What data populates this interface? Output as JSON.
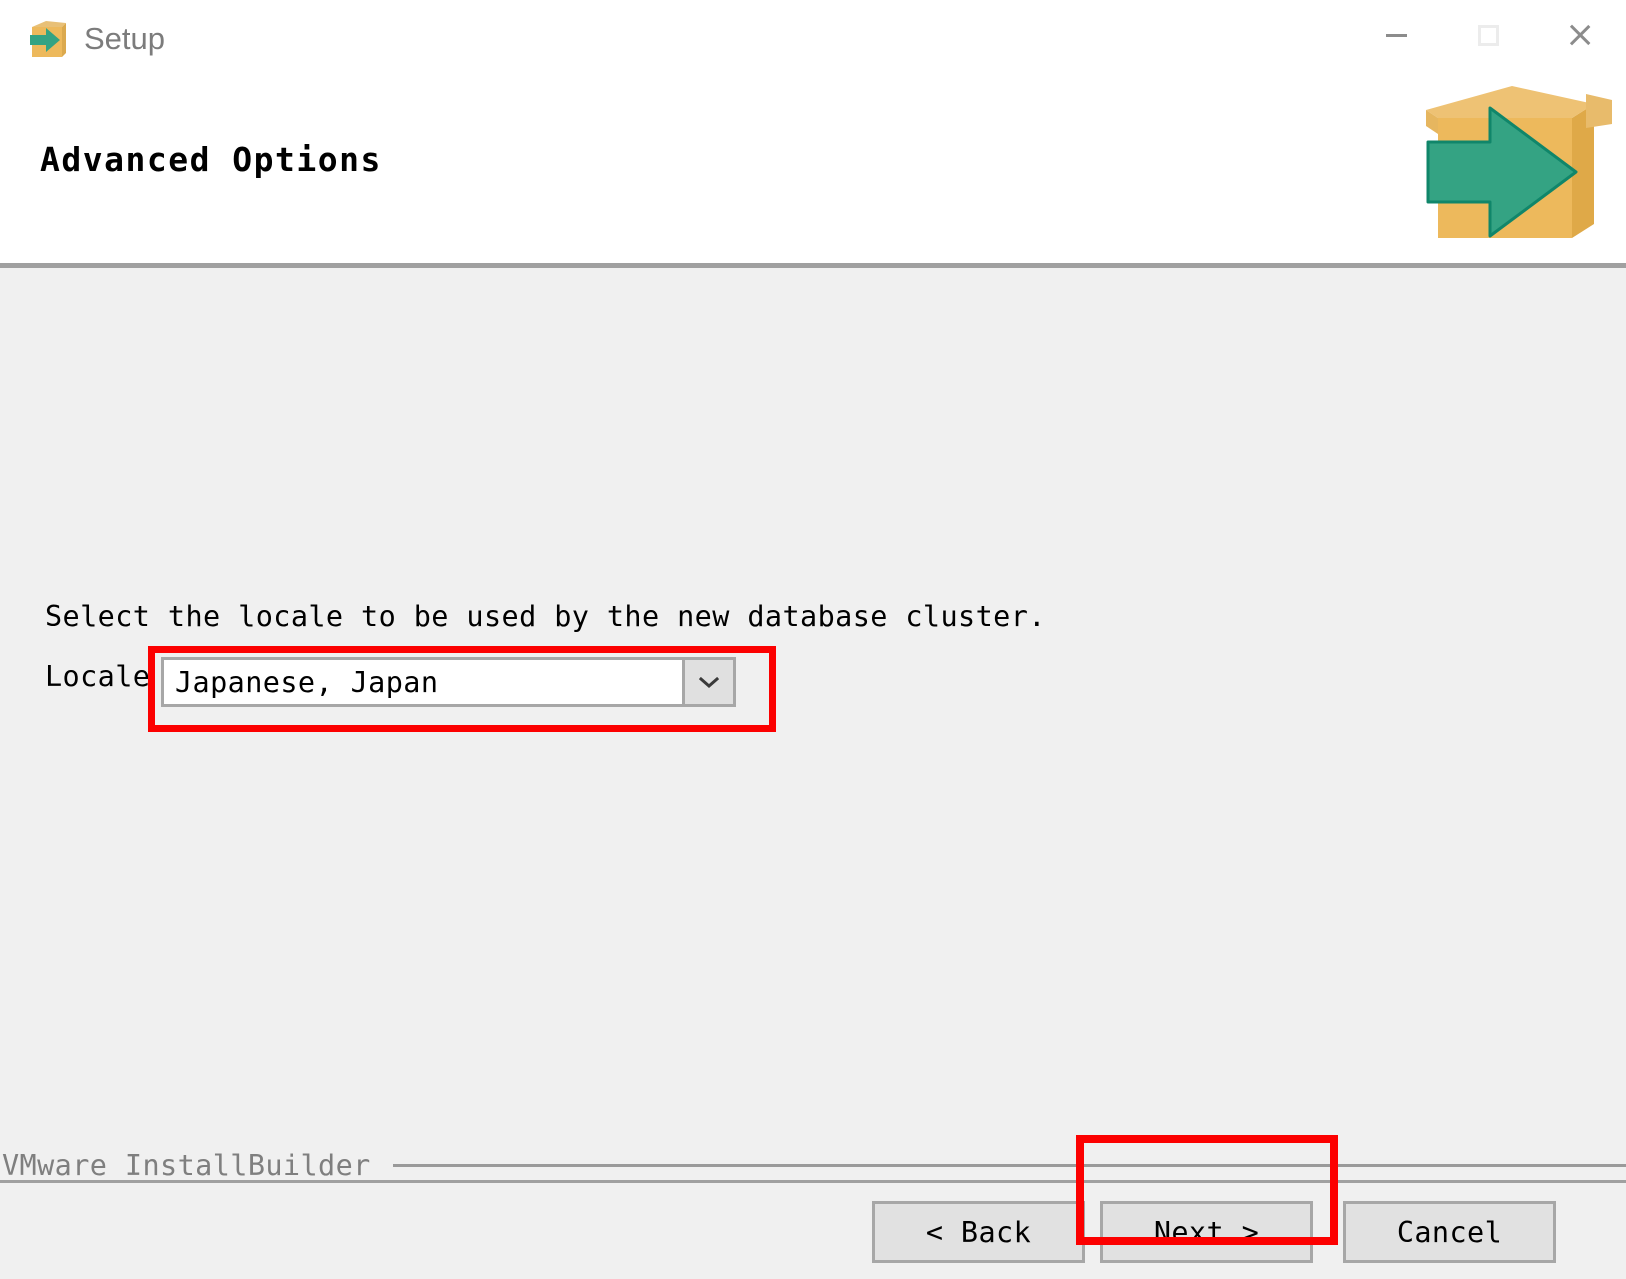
{
  "window": {
    "title": "Setup",
    "app_icon": "package-arrow-icon",
    "controls": {
      "minimize": "minimize-icon",
      "maximize": "maximize-icon",
      "close": "close-icon"
    }
  },
  "header": {
    "title": "Advanced Options",
    "art": "package-arrow-illustration"
  },
  "main": {
    "instruction": "Select the locale to be used by the new database cluster.",
    "locale": {
      "label": "Locale",
      "value": "Japanese, Japan",
      "dropdown_icon": "chevron-down-icon"
    }
  },
  "footer": {
    "brand": "VMware InstallBuilder",
    "buttons": {
      "back": "< Back",
      "next": "Next >",
      "cancel": "Cancel"
    }
  },
  "annotations": {
    "highlight_color": "#fc0000",
    "targets": [
      "locale-combobox",
      "next-button"
    ]
  },
  "colors": {
    "body_bg": "#f0f0f0",
    "header_bg": "#ffffff",
    "separator": "#a0a0a0",
    "title_text": "#7c7c7c",
    "brand_text": "#7f7f7f",
    "box_tan": "#edb95c",
    "arrow_green": "#34a383"
  }
}
